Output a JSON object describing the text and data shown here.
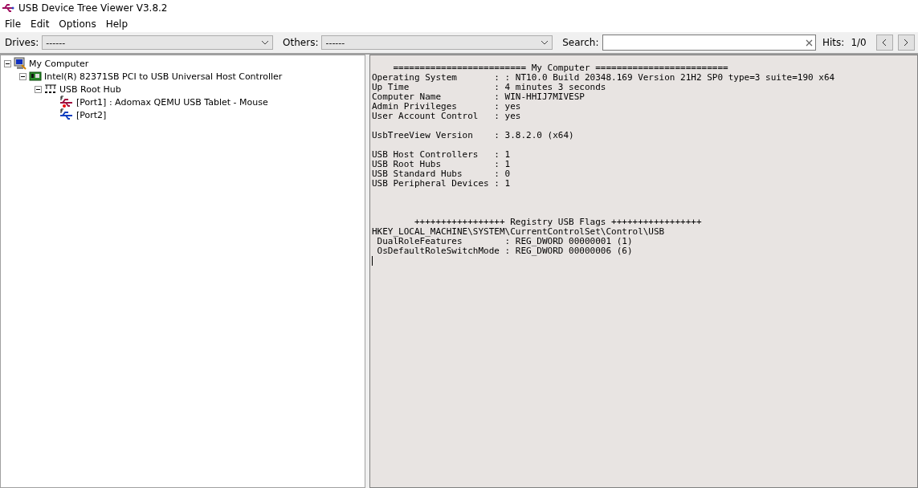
{
  "window": {
    "title": "USB Device Tree Viewer V3.8.2"
  },
  "menu": [
    "File",
    "Edit",
    "Options",
    "Help"
  ],
  "toolbar": {
    "drives_label": "Drives:",
    "drives_value": "------",
    "others_label": "Others:",
    "others_value": "------",
    "search_label": "Search:",
    "hits_label": "Hits:",
    "hits_value": "1/0"
  },
  "tree": [
    {
      "label": "My Computer",
      "kind": "computer",
      "expanded": true,
      "children": [
        {
          "label": "Intel(R) 82371SB PCI to USB Universal Host Controller",
          "kind": "controller",
          "expanded": true,
          "children": [
            {
              "label": "USB Root Hub",
              "kind": "roothub",
              "expanded": true,
              "children": [
                {
                  "label": "[Port1] : Adomax QEMU USB Tablet - Mouse",
                  "kind": "device"
                },
                {
                  "label": "[Port2]",
                  "kind": "port"
                }
              ]
            }
          ]
        }
      ]
    }
  ],
  "details": [
    {
      "kind": "banner",
      "lines": [
        "    ========================= My Computer =========================",
        "Operating System       : : NT10.0 Build 20348.169 Version 21H2 SP0 type=3 suite=190 x64",
        "Up Time                : 4 minutes 3 seconds",
        "Computer Name          : WIN-HHIJ7MIVESP",
        "Admin Privileges       : yes",
        "User Account Control   : yes"
      ]
    },
    {
      "kind": "plain",
      "lines": [
        "UsbTreeView Version    : 3.8.2.0 (x64)"
      ]
    },
    {
      "kind": "plain",
      "lines": [
        "USB Host Controllers   : 1",
        "USB Root Hubs          : 1",
        "USB Standard Hubs      : 0",
        "USB Peripheral Devices : 1"
      ]
    },
    {
      "kind": "banner",
      "lines": [
        "        +++++++++++++++++ Registry USB Flags +++++++++++++++++",
        "HKEY_LOCAL_MACHINE\\SYSTEM\\CurrentControlSet\\Control\\USB",
        " DualRoleFeatures        : REG_DWORD 00000001 (1)",
        " OsDefaultRoleSwitchMode : REG_DWORD 00000006 (6)"
      ]
    }
  ]
}
